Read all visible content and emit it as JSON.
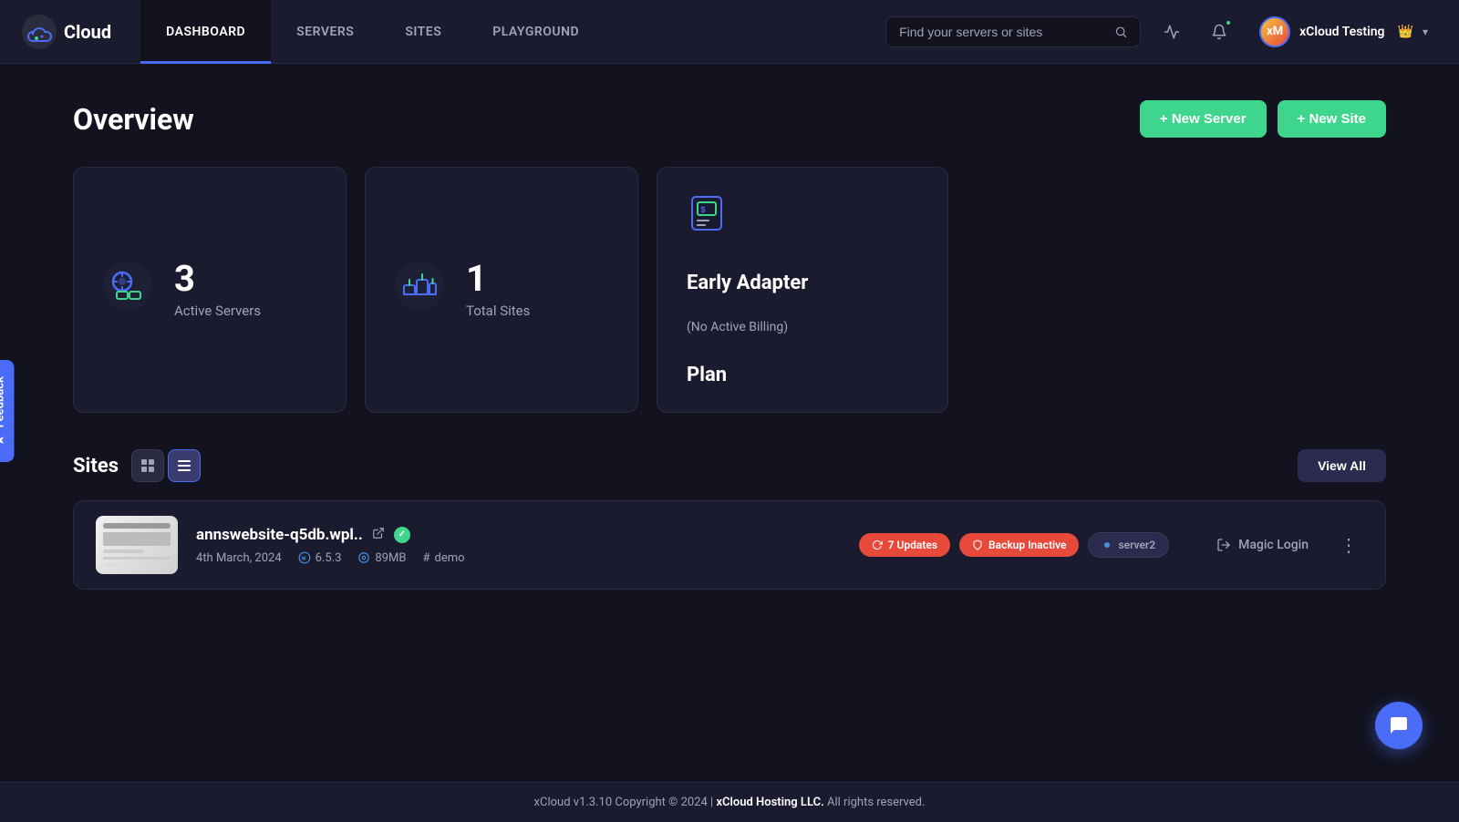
{
  "app": {
    "logo_text": "Cloud",
    "version": "v1.3.10",
    "copyright": "Copyright © 2024 |",
    "company": "xCloud Hosting LLC.",
    "rights": "All rights reserved."
  },
  "nav": {
    "items": [
      {
        "id": "dashboard",
        "label": "DASHBOARD",
        "active": true
      },
      {
        "id": "servers",
        "label": "SERVERS",
        "active": false
      },
      {
        "id": "sites",
        "label": "SITES",
        "active": false
      },
      {
        "id": "playground",
        "label": "PLAYGROUND",
        "active": false
      }
    ]
  },
  "header": {
    "search_placeholder": "Find your servers or sites",
    "user_name": "xCloud Testing",
    "user_initials": "xM"
  },
  "overview": {
    "title": "Overview",
    "new_server_label": "+ New Server",
    "new_site_label": "+ New Site"
  },
  "stats": {
    "active_servers": {
      "count": "3",
      "label": "Active Servers"
    },
    "total_sites": {
      "count": "1",
      "label": "Total Sites"
    },
    "plan": {
      "title": "Early Adapter",
      "subtitle": "(No Active Billing)",
      "label": "Plan"
    }
  },
  "sites_section": {
    "title": "Sites",
    "view_all_label": "View All"
  },
  "site": {
    "name": "annswebsite-q5db.wpl..",
    "date": "4th March, 2024",
    "wp_version": "6.5.3",
    "disk": "89MB",
    "tag": "demo",
    "badge_updates": "7 Updates",
    "badge_backup": "Backup Inactive",
    "badge_server": "server2",
    "magic_login_label": "Magic Login"
  },
  "feedback": {
    "label": "Feedback",
    "icon": "★"
  },
  "footer": {
    "text_prefix": "xCloud",
    "version": "v1.3.10",
    "copyright": "Copyright © 2024 |",
    "company": "xCloud Hosting LLC.",
    "rights": "All rights reserved."
  }
}
